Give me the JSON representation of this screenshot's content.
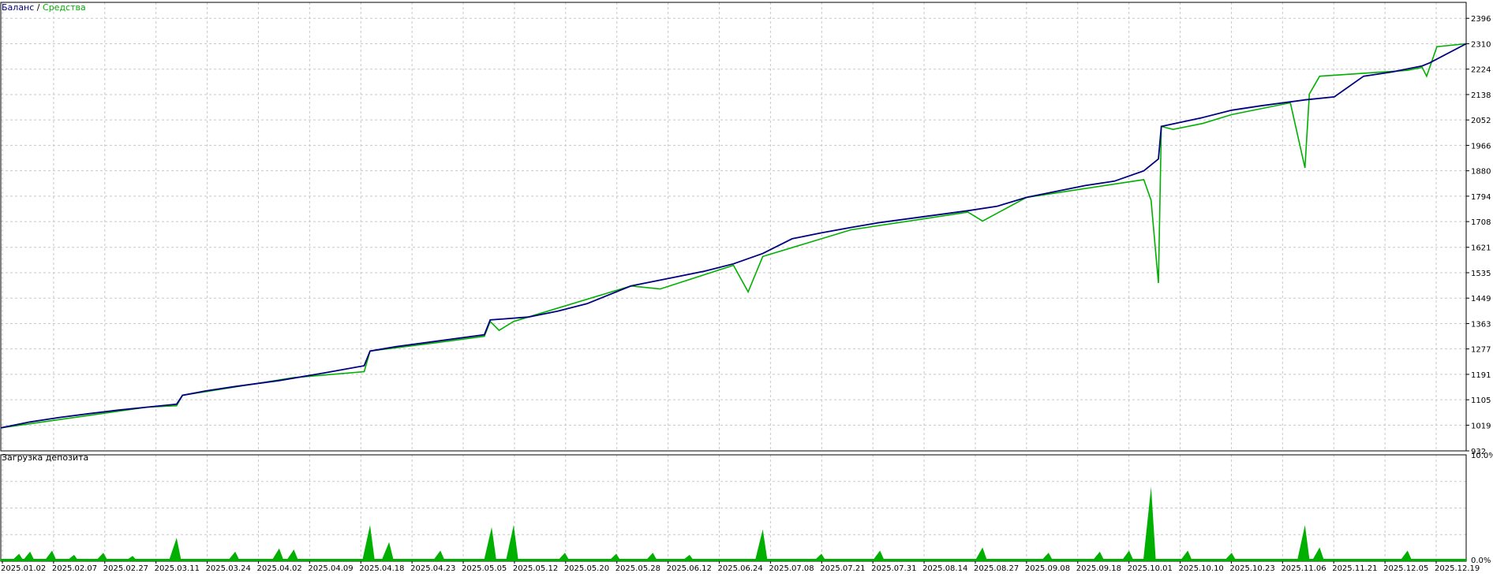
{
  "colors": {
    "balance": "#000080",
    "equity": "#00b000",
    "load": "#00b000",
    "grid": "#c8c8c8",
    "axis": "#000000",
    "background": "#ffffff"
  },
  "chart_data": [
    {
      "type": "line",
      "legend_balance": "Баланс",
      "legend_separator": " / ",
      "legend_equity": "Средства",
      "legend_position": "top-left",
      "grid": true,
      "ylim": [
        932,
        2450
      ],
      "yticks": [
        932,
        1019,
        1105,
        1191,
        1277,
        1363,
        1449,
        1535,
        1621,
        1708,
        1794,
        1880,
        1966,
        2052,
        2138,
        2224,
        2310,
        2396
      ],
      "ytick_labels": [
        "932",
        "1019",
        "1105",
        "1191",
        "1277",
        "1363",
        "1449",
        "1535",
        "1621",
        "1708",
        "1794",
        "1880",
        "1966",
        "2052",
        "2138",
        "2224",
        "2310",
        "2396"
      ],
      "series": [
        {
          "name": "Баланс",
          "t": [
            0,
            0.02,
            0.04,
            0.06,
            0.08,
            0.1,
            0.12,
            0.124,
            0.14,
            0.16,
            0.19,
            0.22,
            0.248,
            0.252,
            0.27,
            0.3,
            0.33,
            0.334,
            0.36,
            0.38,
            0.4,
            0.43,
            0.46,
            0.48,
            0.5,
            0.52,
            0.54,
            0.56,
            0.58,
            0.6,
            0.63,
            0.66,
            0.68,
            0.7,
            0.72,
            0.74,
            0.76,
            0.78,
            0.79,
            0.792,
            0.82,
            0.84,
            0.86,
            0.89,
            0.91,
            0.93,
            0.95,
            0.97,
            0.975,
            1.0
          ],
          "values": [
            1010,
            1030,
            1045,
            1058,
            1070,
            1080,
            1090,
            1120,
            1135,
            1150,
            1170,
            1195,
            1220,
            1270,
            1285,
            1305,
            1325,
            1375,
            1385,
            1405,
            1430,
            1490,
            1520,
            1540,
            1565,
            1600,
            1650,
            1670,
            1688,
            1705,
            1725,
            1745,
            1760,
            1790,
            1810,
            1830,
            1845,
            1880,
            1920,
            2030,
            2060,
            2085,
            2100,
            2120,
            2130,
            2200,
            2215,
            2235,
            2245,
            2310
          ]
        },
        {
          "name": "Средства",
          "t": [
            0,
            0.1,
            0.12,
            0.124,
            0.2,
            0.248,
            0.252,
            0.3,
            0.33,
            0.334,
            0.34,
            0.35,
            0.36,
            0.43,
            0.45,
            0.5,
            0.51,
            0.52,
            0.58,
            0.66,
            0.67,
            0.7,
            0.78,
            0.785,
            0.79,
            0.792,
            0.8,
            0.82,
            0.84,
            0.86,
            0.88,
            0.89,
            0.893,
            0.9,
            0.96,
            0.97,
            0.973,
            0.98,
            1.0
          ],
          "values": [
            1010,
            1080,
            1085,
            1120,
            1180,
            1200,
            1270,
            1300,
            1320,
            1370,
            1340,
            1370,
            1385,
            1490,
            1480,
            1560,
            1470,
            1590,
            1680,
            1740,
            1710,
            1790,
            1850,
            1780,
            1500,
            2030,
            2020,
            2040,
            2070,
            2090,
            2110,
            1890,
            2140,
            2200,
            2220,
            2230,
            2200,
            2300,
            2310
          ]
        }
      ]
    },
    {
      "type": "bar",
      "title": "Загрузка депозита",
      "ylim": [
        0,
        10
      ],
      "ytick_labels": [
        "10.0%",
        "0.0%"
      ],
      "spikes": [
        {
          "t": 0.0125,
          "v": 0.7
        },
        {
          "t": 0.02,
          "v": 0.9
        },
        {
          "t": 0.035,
          "v": 1.0
        },
        {
          "t": 0.05,
          "v": 0.6
        },
        {
          "t": 0.07,
          "v": 0.8
        },
        {
          "t": 0.09,
          "v": 0.5
        },
        {
          "t": 0.12,
          "v": 2.2
        },
        {
          "t": 0.16,
          "v": 0.9
        },
        {
          "t": 0.19,
          "v": 1.2
        },
        {
          "t": 0.2,
          "v": 1.1
        },
        {
          "t": 0.252,
          "v": 3.4
        },
        {
          "t": 0.265,
          "v": 1.8
        },
        {
          "t": 0.3,
          "v": 1.0
        },
        {
          "t": 0.335,
          "v": 3.2
        },
        {
          "t": 0.35,
          "v": 3.4
        },
        {
          "t": 0.385,
          "v": 0.8
        },
        {
          "t": 0.42,
          "v": 0.7
        },
        {
          "t": 0.445,
          "v": 0.8
        },
        {
          "t": 0.47,
          "v": 0.6
        },
        {
          "t": 0.52,
          "v": 3.0
        },
        {
          "t": 0.56,
          "v": 0.7
        },
        {
          "t": 0.6,
          "v": 1.0
        },
        {
          "t": 0.67,
          "v": 1.3
        },
        {
          "t": 0.715,
          "v": 0.8
        },
        {
          "t": 0.75,
          "v": 0.9
        },
        {
          "t": 0.77,
          "v": 1.0
        },
        {
          "t": 0.785,
          "v": 7.0
        },
        {
          "t": 0.81,
          "v": 1.0
        },
        {
          "t": 0.84,
          "v": 0.8
        },
        {
          "t": 0.89,
          "v": 3.4
        },
        {
          "t": 0.9,
          "v": 1.3
        },
        {
          "t": 0.96,
          "v": 1.0
        }
      ]
    }
  ],
  "x_axis": {
    "labels": [
      "2025.01.02",
      "2025.02.07",
      "2025.02.27",
      "2025.03.11",
      "2025.03.24",
      "2025.04.02",
      "2025.04.09",
      "2025.04.18",
      "2025.04.23",
      "2025.05.05",
      "2025.05.12",
      "2025.05.20",
      "2025.05.28",
      "2025.06.12",
      "2025.06.24",
      "2025.07.08",
      "2025.07.21",
      "2025.07.31",
      "2025.08.14",
      "2025.08.27",
      "2025.09.08",
      "2025.09.18",
      "2025.10.01",
      "2025.10.10",
      "2025.10.23",
      "2025.11.06",
      "2025.11.21",
      "2025.12.05",
      "2025.12.19"
    ]
  }
}
